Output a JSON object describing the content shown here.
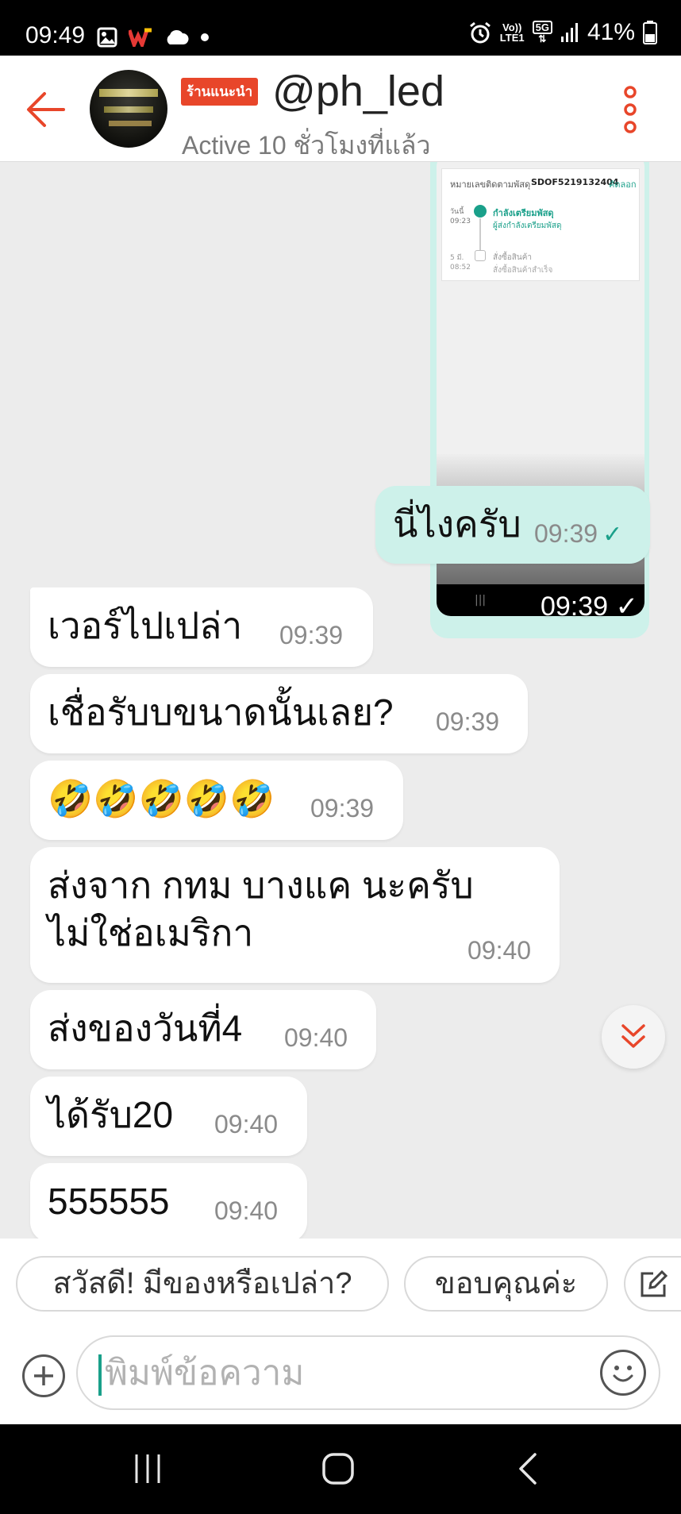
{
  "status_bar": {
    "time": "09:49",
    "network_label_top": "Vo))",
    "network_label_bottom": "LTE1",
    "network_type": "5G",
    "battery_percent": "41%",
    "icons": [
      "gallery-icon",
      "app-w-icon",
      "cloud-icon",
      "dot-icon",
      "alarm-icon",
      "signal-icon",
      "battery-icon"
    ]
  },
  "header": {
    "badge": "ร้านแนะนำ",
    "shop_name": "@ph_led",
    "status": "Active 10 ชั่วโมงที่แล้ว",
    "accent_color": "#e8462a"
  },
  "tracking_preview": {
    "title": "หมายเลขติดตามพัสดุ",
    "tracking_code": "SDOF5219132404",
    "copy_link": "คัดลอก",
    "step1_date": "วันนี้",
    "step1_time": "09:23",
    "step1_title": "กำลังเตรียมพัสดุ",
    "step1_desc": "ผู้ส่งกำลังเตรียมพัสดุ",
    "step2_date": "5 มี.",
    "step2_time": "08:52",
    "step2_title": "สั่งซื้อสินค้า",
    "step2_desc": "สั่งซื้อสินค้าสำเร็จ",
    "nav_lines": "|||",
    "time": "09:39"
  },
  "messages": [
    {
      "direction": "out",
      "text": "นี่ไงครับ",
      "time": "09:39",
      "read": true
    },
    {
      "direction": "in",
      "text": "เวอร์ไปเปล่า",
      "time": "09:39"
    },
    {
      "direction": "in",
      "text": "เชื่อรับบขนาดนั้นเลย?",
      "time": "09:39"
    },
    {
      "direction": "in",
      "text": "🤣🤣🤣🤣🤣",
      "time": "09:39"
    },
    {
      "direction": "in",
      "text_line1": "ส่งจาก กทม บางแค นะครับ",
      "text_line2": "ไม่ใช่อเมริกา",
      "time": "09:40"
    },
    {
      "direction": "in",
      "text": "ส่งของวันที่4",
      "time": "09:40"
    },
    {
      "direction": "in",
      "text": "ได้รับ20",
      "time": "09:40"
    },
    {
      "direction": "in",
      "text": "555555",
      "time": "09:40"
    }
  ],
  "quick_replies": [
    "สวัสดี! มีของหรือเปล่า?",
    "ขอบคุณค่ะ"
  ],
  "input": {
    "placeholder": "พิมพ์ข้อความ",
    "value": ""
  },
  "colors": {
    "accent": "#e8462a",
    "outgoing_bubble": "#cdf1ea",
    "check": "#1aa08a",
    "background": "#ececec"
  }
}
